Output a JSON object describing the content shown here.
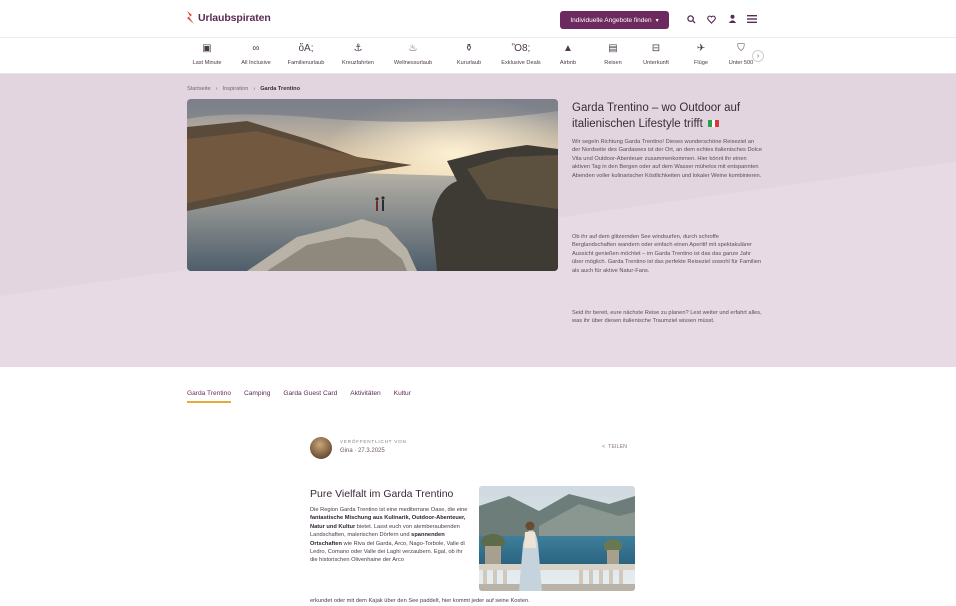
{
  "header": {
    "logo_text": "Urlaubspiraten",
    "cta_label": "Individuelle Angebote finden",
    "icons": [
      "search-icon",
      "heart-icon",
      "user-icon",
      "menu-icon"
    ],
    "brand_color": "#6d2a5f"
  },
  "categories": [
    {
      "icon": "suitcase-icon",
      "label": "Last Minute"
    },
    {
      "icon": "infinity-icon",
      "label": "All Inclusive"
    },
    {
      "icon": "family-icon",
      "label": "Familienurlaub"
    },
    {
      "icon": "anchor-icon",
      "label": "Kreuzfahrten"
    },
    {
      "icon": "spa-icon",
      "label": "Wellnessurlaub"
    },
    {
      "icon": "spa-bottle-icon",
      "label": "Kururlaub"
    },
    {
      "icon": "cocktail-icon",
      "label": "Exklusive Deals"
    },
    {
      "icon": "airbnb-icon",
      "label": "Airbnb"
    },
    {
      "icon": "luggage-icon",
      "label": "Reisen"
    },
    {
      "icon": "bed-icon",
      "label": "Unterkunft"
    },
    {
      "icon": "plane-icon",
      "label": "Flüge"
    },
    {
      "icon": "tag-icon",
      "label": "Unter 500"
    }
  ],
  "breadcrumb": [
    "Startseite",
    "Inspiration",
    "Garda Trentino"
  ],
  "hero": {
    "title": "Garda Trentino – wo Outdoor auf italienischen Lifestyle trifft",
    "paragraphs": [
      "Wir segeln Richtung Garda Trentino! Dieses wunderschöne Reiseziel an der Nordseite des Gardasees ist der Ort, an dem echtes italienisches Dolce Vita und Outdoor-Abenteuer zusammenkommen. Hier könnt ihr einen aktiven Tag in den Bergen oder auf dem Wasser mühelos mit entspannten Abenden voller kulinarischer Köstlichkeiten und lokaler Weine kombinieren.",
      "Ob ihr auf dem glitzernden See windsurfen, durch schroffe Berglandschaften wandern oder einfach einen Aperitif mit spektakulärer Aussicht genießen möchtet – im Garda Trentino ist das das ganze Jahr über möglich. Garda Trentino ist das perfekte Reiseziel sowohl für Familien als auch für aktive Natur-Fans.",
      "Seid ihr bereit, eure nächste Reise zu planen? Lest weiter und erfahrt alles, was ihr über diesen italienische Traumziel wissen müsst."
    ]
  },
  "tabs": [
    "Garda Trentino",
    "Camping",
    "Garda Guest Card",
    "Aktivitäten",
    "Kultur"
  ],
  "author": {
    "label": "VERÖFFENTLICHT VON",
    "name_date": "Gina · 27.3.2025",
    "share_label": "TEILEN"
  },
  "article": {
    "title": "Pure Vielfalt im Garda Trentino",
    "body_1": "Die Region Garda Trentino ist eine mediterrane Oase, die eine ",
    "bold_1": "fantastische Mischung aus Kulinarik, Outdoor-Abenteuer, Natur und Kultur",
    "body_2": " bietet. Lasst euch von atemberaubenden Landschaften, malerischen Dörfern und ",
    "bold_2": "spannenden Ortschaften",
    "body_3": " wie Riva del Garda, Arco, Nago-Torbole, Valle di Ledro, Comano oder Valle dei Laghi verzaubern. Egal, ob ihr die historischen Olivenhaine der Arco",
    "tail": "erkundet oder mit dem Kajak über den See paddelt, hier kommt jeder auf seine Kosten."
  }
}
